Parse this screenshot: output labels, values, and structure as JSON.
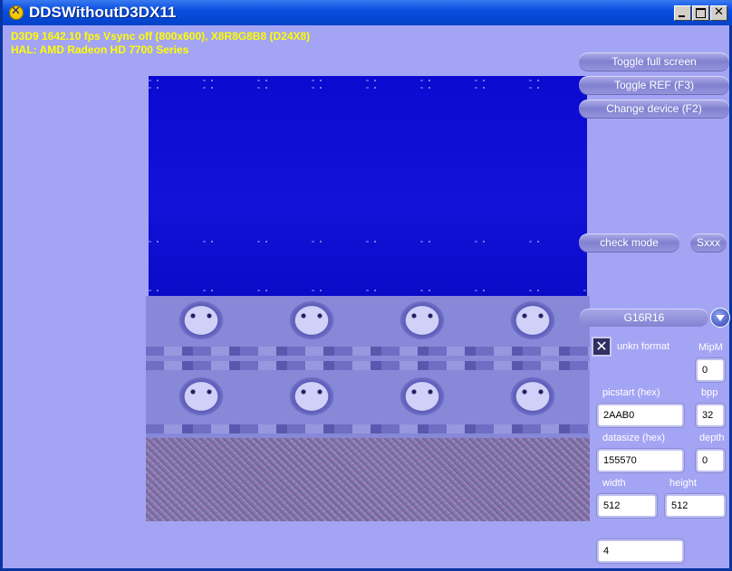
{
  "window": {
    "title": "DDSWithoutD3DX11"
  },
  "stats": {
    "line1": "D3D9 1642.10 fps Vsync off (800x600), X8R8G8B8 (D24X8)",
    "line2": "HAL: AMD Radeon HD 7700 Series"
  },
  "buttons": {
    "toggle_fullscreen": "Toggle full screen",
    "toggle_ref": "Toggle REF (F3)",
    "change_device": "Change device (F2)",
    "check_mode": "check mode",
    "sxxx": "Sxxx"
  },
  "format_combo": {
    "selected": "G16R16"
  },
  "unkn_format": {
    "label": "unkn format",
    "checked": true
  },
  "fields": {
    "mipm": {
      "label": "MipM",
      "value": "0"
    },
    "picstart": {
      "label": "picstart  (hex)",
      "value": "2AAB0"
    },
    "bpp": {
      "label": "bpp",
      "value": "32"
    },
    "datasize": {
      "label": "datasize  (hex)",
      "value": "155570"
    },
    "depth": {
      "label": "depth",
      "value": "0"
    },
    "width": {
      "label": "width",
      "value": "512"
    },
    "height": {
      "label": "height",
      "value": "512"
    },
    "extra": {
      "value": "4"
    }
  },
  "colors": {
    "background": "#a4a4f4",
    "titlebar": "#0a4ee0",
    "stats_text": "#ffff00"
  },
  "icons": {
    "app": "app-icon",
    "minimize": "minimize-icon",
    "maximize": "maximize-icon",
    "close": "close-icon",
    "dropdown": "chevron-down-icon",
    "check": "check-icon"
  }
}
